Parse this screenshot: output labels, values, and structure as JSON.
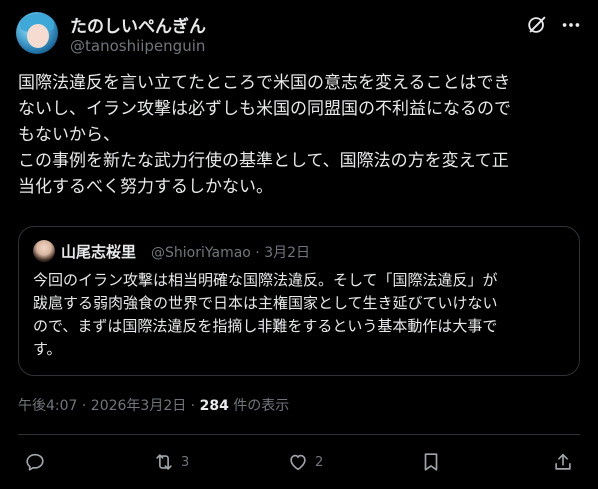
{
  "author": {
    "display_name": "たのしいぺんぎん",
    "handle": "@tanoshiipenguin"
  },
  "post": {
    "lines": [
      "国際法違反を言い立てたところで米国の意志を変えることはでき",
      "ないし、イラン攻撃は必ずしも米国の同盟国の不利益になるので",
      "もないから、",
      "この事例を新たな武力行使の基準として、国際法の方を変えて正",
      "当化するべく努力するしかない。"
    ]
  },
  "quote": {
    "display_name": "山尾志桜里",
    "meta": "@ShioriYamao · 3月2日",
    "lines": [
      "今回のイラン攻撃は相当明確な国際法違反。そして「国際法違反」が",
      "跋扈する弱肉強食の世界で日本は主権国家として生き延びていけない",
      "ので、まずは国際法違反を指摘し非難をするという基本動作は大事で",
      "す。"
    ]
  },
  "meta": {
    "timestamp": "午後4:07 · 2026年3月2日 · ",
    "views_count": "284",
    "views_label": " 件の表示"
  },
  "actions": {
    "reply_count": "",
    "repost_count": "3",
    "like_count": "2"
  },
  "icons": {
    "grok": "grok-icon",
    "more": "more-icon",
    "reply": "reply-icon",
    "repost": "repost-icon",
    "like": "heart-icon",
    "bookmark": "bookmark-icon",
    "share": "share-icon"
  },
  "colors": {
    "background": "#000000",
    "text_primary": "#e7e9ea",
    "text_secondary": "#71767b",
    "border": "#2f3336"
  }
}
